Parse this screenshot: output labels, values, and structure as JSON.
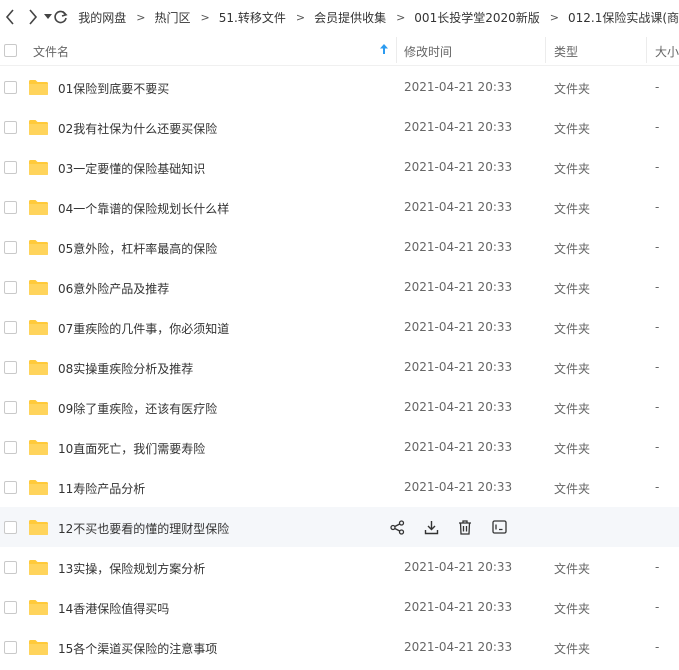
{
  "breadcrumb": [
    "我的网盘",
    "热门区",
    "51.转移文件",
    "会员提供收集",
    "001长投学堂2020新版",
    "012.1保险实战课(商"
  ],
  "breadcrumb_separator": ">",
  "columns": {
    "name": "文件名",
    "mtime": "修改时间",
    "type": "类型",
    "size": "大小"
  },
  "rows": [
    {
      "name": "01保险到底要不要买",
      "mtime": "2021-04-21 20:33",
      "type": "文件夹",
      "size": "-"
    },
    {
      "name": "02我有社保为什么还要买保险",
      "mtime": "2021-04-21 20:33",
      "type": "文件夹",
      "size": "-"
    },
    {
      "name": "03一定要懂的保险基础知识",
      "mtime": "2021-04-21 20:33",
      "type": "文件夹",
      "size": "-"
    },
    {
      "name": "04一个靠谱的保险规划长什么样",
      "mtime": "2021-04-21 20:33",
      "type": "文件夹",
      "size": "-"
    },
    {
      "name": "05意外险，杠杆率最高的保险",
      "mtime": "2021-04-21 20:33",
      "type": "文件夹",
      "size": "-"
    },
    {
      "name": "06意外险产品及推荐",
      "mtime": "2021-04-21 20:33",
      "type": "文件夹",
      "size": "-"
    },
    {
      "name": "07重疾险的几件事，你必须知道",
      "mtime": "2021-04-21 20:33",
      "type": "文件夹",
      "size": "-"
    },
    {
      "name": "08实操重疾险分析及推荐",
      "mtime": "2021-04-21 20:33",
      "type": "文件夹",
      "size": "-"
    },
    {
      "name": "09除了重疾险，还该有医疗险",
      "mtime": "2021-04-21 20:33",
      "type": "文件夹",
      "size": "-"
    },
    {
      "name": "10直面死亡，我们需要寿险",
      "mtime": "2021-04-21 20:33",
      "type": "文件夹",
      "size": "-"
    },
    {
      "name": "11寿险产品分析",
      "mtime": "2021-04-21 20:33",
      "type": "文件夹",
      "size": "-"
    },
    {
      "name": "12不买也要看的懂的理财型保险",
      "mtime": "",
      "type": "",
      "size": "",
      "hover": true
    },
    {
      "name": "13实操，保险规划方案分析",
      "mtime": "2021-04-21 20:33",
      "type": "文件夹",
      "size": "-"
    },
    {
      "name": "14香港保险值得买吗",
      "mtime": "2021-04-21 20:33",
      "type": "文件夹",
      "size": "-"
    },
    {
      "name": "15各个渠道买保险的注意事项",
      "mtime": "2021-04-21 20:33",
      "type": "文件夹",
      "size": "-"
    }
  ],
  "icons": {
    "folder": "folder-icon",
    "share": "share-icon",
    "download": "download-icon",
    "delete": "trash-icon",
    "more": "terminal-icon",
    "sort": "sort-ascending-icon"
  },
  "colors": {
    "folder": "#FFCA3A",
    "sort_arrow": "#2c9bf0",
    "hover_row": "#f5f7fa"
  }
}
